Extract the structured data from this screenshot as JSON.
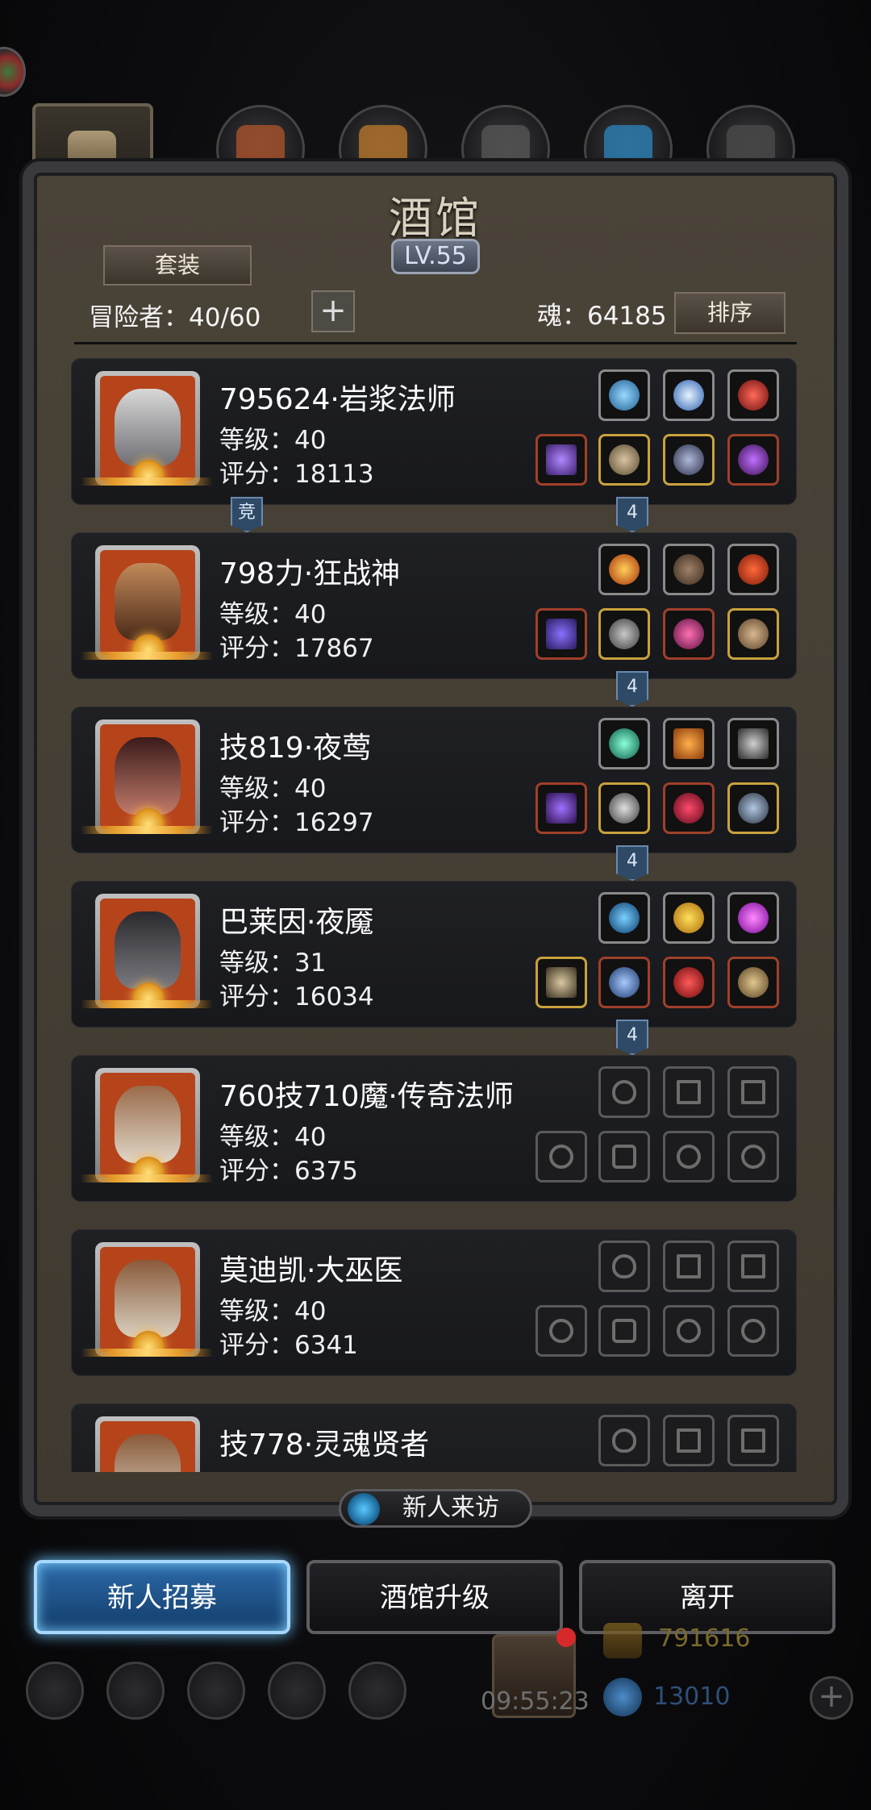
{
  "header": {
    "title": "酒馆",
    "level": "LV.55",
    "set_button": "套装",
    "adventurers": "冒险者：40/60",
    "add_symbol": "+",
    "soul": "魂：64185",
    "sort_button": "排序"
  },
  "heroes": [
    {
      "name": "795624·岩浆法师",
      "level": "等级：40",
      "score": "评分：18113"
    },
    {
      "name": "798力·狂战神",
      "level": "等级：40",
      "score": "评分：17867"
    },
    {
      "name": "技819·夜莺",
      "level": "等级：40",
      "score": "评分：16297"
    },
    {
      "name": "巴莱因·夜魇",
      "level": "等级：31",
      "score": "评分：16034"
    },
    {
      "name": "760技710魔·传奇法师",
      "level": "等级：40",
      "score": "评分：6375"
    },
    {
      "name": "莫迪凯·大巫医",
      "level": "等级：40",
      "score": "评分：6341"
    },
    {
      "name": "技778·灵魂贤者",
      "level": "",
      "score": ""
    }
  ],
  "tags": {
    "arena": "竞",
    "count": "4"
  },
  "bottom": {
    "visit": "新人来访",
    "recruit": "新人招募",
    "upgrade": "酒馆升级",
    "leave": "离开",
    "timer": "09:55:23",
    "gold": "791616",
    "gems": "13010",
    "plus": "+"
  },
  "colors": {
    "recruit_accent": "#6fc7ff",
    "frame": "#3a3a3e",
    "panel": "#4a4338"
  }
}
